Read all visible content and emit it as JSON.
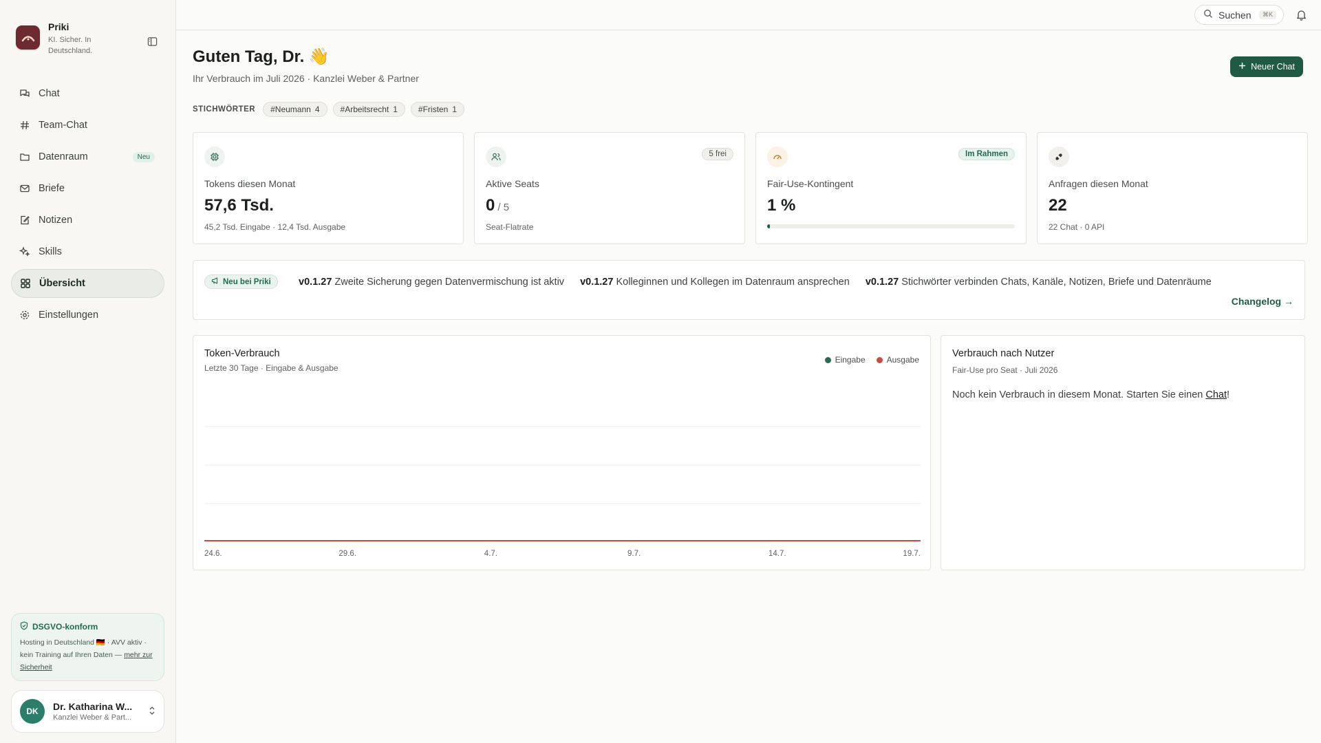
{
  "brand": {
    "name": "Priki",
    "tagline": "KI. Sicher. In Deutschland."
  },
  "nav": [
    {
      "label": "Chat",
      "icon": "chat-icon"
    },
    {
      "label": "Team-Chat",
      "icon": "hash-icon"
    },
    {
      "label": "Datenraum",
      "icon": "folder-icon",
      "badge": "Neu"
    },
    {
      "label": "Briefe",
      "icon": "mail-icon"
    },
    {
      "label": "Notizen",
      "icon": "note-icon"
    },
    {
      "label": "Skills",
      "icon": "sparkles-icon"
    },
    {
      "label": "Übersicht",
      "icon": "dashboard-icon",
      "active": true
    },
    {
      "label": "Einstellungen",
      "icon": "gear-icon"
    }
  ],
  "dsgvo": {
    "title": "DSGVO-konform",
    "text": "Hosting in Deutschland 🇩🇪 · AVV aktiv · kein Training auf Ihren Daten —",
    "link": "mehr zur Sicherheit"
  },
  "user": {
    "initials": "DK",
    "name": "Dr. Katharina W...",
    "org": "Kanzlei Weber & Part..."
  },
  "topbar": {
    "search_label": "Suchen",
    "search_shortcut": "⌘K"
  },
  "header": {
    "greeting": "Guten Tag, Dr. 👋",
    "subtitle": "Ihr Verbrauch im Juli 2026 · Kanzlei Weber & Partner",
    "new_chat": "Neuer Chat"
  },
  "tags": {
    "label": "STICHWÖRTER",
    "items": [
      {
        "name": "#Neumann",
        "count": "4"
      },
      {
        "name": "#Arbeitsrecht",
        "count": "1"
      },
      {
        "name": "#Fristen",
        "count": "1"
      }
    ]
  },
  "cards": {
    "tokens": {
      "label": "Tokens diesen Monat",
      "value": "57,6 Tsd.",
      "sub": "45,2 Tsd. Eingabe · 12,4 Tsd. Ausgabe"
    },
    "seats": {
      "label": "Aktive Seats",
      "value": "0",
      "suffix": "/ 5",
      "sub": "Seat-Flatrate",
      "badge": "5 frei"
    },
    "fairuse": {
      "label": "Fair-Use-Kontingent",
      "value": "1 %",
      "badge": "Im Rahmen",
      "progress": 0.01
    },
    "requests": {
      "label": "Anfragen diesen Monat",
      "value": "22",
      "sub": "22 Chat · 0 API"
    }
  },
  "news": {
    "badge": "Neu bei Priki",
    "items": [
      {
        "version": "v0.1.27",
        "text": "Zweite Sicherung gegen Datenvermischung ist aktiv"
      },
      {
        "version": "v0.1.27",
        "text": "Kolleginnen und Kollegen im Datenraum ansprechen"
      },
      {
        "version": "v0.1.27",
        "text": "Stichwörter verbinden Chats, Kanäle, Notizen, Briefe und Datenräume"
      }
    ],
    "changelog": "Changelog →"
  },
  "usage_chart": {
    "title": "Token-Verbrauch",
    "subtitle": "Letzte 30 Tage · Eingabe & Ausgabe",
    "legend": [
      {
        "name": "Eingabe",
        "color": "#2a6b53"
      },
      {
        "name": "Ausgabe",
        "color": "#c94a3e"
      }
    ]
  },
  "chart_data": {
    "type": "line",
    "title": "Token-Verbrauch",
    "x_tick_labels": [
      "24.6.",
      "29.6.",
      "4.7.",
      "9.7.",
      "14.7.",
      "19.7."
    ],
    "series": [
      {
        "name": "Eingabe",
        "color": "#2a6b53",
        "values": [
          0,
          0,
          0,
          0,
          0,
          0
        ]
      },
      {
        "name": "Ausgabe",
        "color": "#c94a3e",
        "values": [
          0,
          0,
          0,
          0,
          0,
          0
        ]
      }
    ],
    "grid": true,
    "legend_position": "top-right"
  },
  "users_panel": {
    "title": "Verbrauch nach Nutzer",
    "subtitle": "Fair-Use pro Seat · Juli 2026",
    "empty_text": "Noch kein Verbrauch in diesem Monat. Starten Sie einen",
    "empty_link": "Chat",
    "empty_end": "!"
  }
}
